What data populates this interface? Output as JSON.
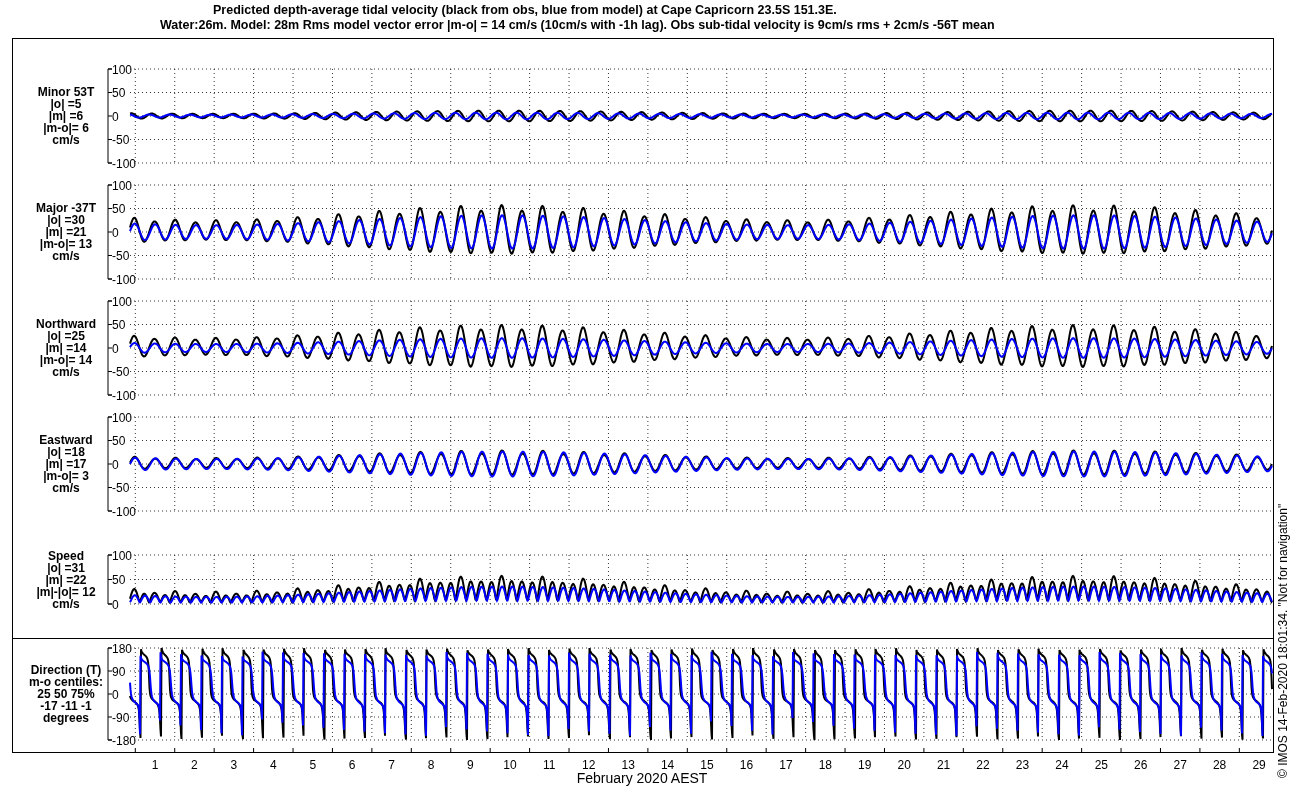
{
  "title_lines": [
    "Predicted depth-average tidal velocity (black from obs, blue from model) at Cape Capricorn 23.5S 151.3E.",
    "Water:26m. Model: 28m  Rms model vector error |m-o| = 14 cm/s (10cm/s with -1h lag). Obs sub-tidal velocity is 9cm/s rms + 2cm/s -56T mean"
  ],
  "traces": [
    {
      "color": "#000000"
    },
    {
      "color": "#0000ff"
    }
  ],
  "panels": [
    {
      "kind": "minor",
      "label_lines": [
        "Minor 53T",
        "|o| =5",
        "|m| =6",
        "|m-o|= 6",
        "cm/s"
      ],
      "yticks": [
        "100",
        "50",
        "0",
        "-50",
        "-100"
      ]
    },
    {
      "kind": "major",
      "label_lines": [
        "Major -37T",
        "|o| =30",
        "|m| =21",
        "|m-o|= 13",
        "cm/s"
      ],
      "yticks": [
        "100",
        "50",
        "0",
        "-50",
        "-100"
      ]
    },
    {
      "kind": "north",
      "label_lines": [
        "Northward",
        "|o| =25",
        "|m| =14",
        "|m-o|= 14",
        "cm/s"
      ],
      "yticks": [
        "100",
        "50",
        "0",
        "-50",
        "-100"
      ]
    },
    {
      "kind": "east",
      "label_lines": [
        "Eastward",
        "|o| =18",
        "|m| =17",
        "|m-o|= 3",
        "cm/s"
      ],
      "yticks": [
        "100",
        "50",
        "0",
        "-50",
        "-100"
      ]
    },
    {
      "kind": "speed",
      "label_lines": [
        "Speed",
        "|o| =31",
        "|m| =22",
        "|m|-|o|= 12",
        "cm/s"
      ],
      "yticks": [
        "100",
        "50",
        "0"
      ]
    },
    {
      "kind": "direction",
      "label_lines": [
        "Direction (T)",
        "m-o centiles:",
        "25  50  75%",
        "-17 -11  -1",
        "degrees"
      ],
      "yticks": [
        "180",
        "90",
        "0",
        "-90",
        "-180"
      ]
    }
  ],
  "x_labels": [
    "1",
    "2",
    "3",
    "4",
    "5",
    "6",
    "7",
    "8",
    "9",
    "10",
    "11",
    "12",
    "13",
    "14",
    "15",
    "16",
    "17",
    "18",
    "19",
    "20",
    "21",
    "22",
    "23",
    "24",
    "25",
    "26",
    "27",
    "28",
    "29"
  ],
  "xlabel": "February 2020 AEST",
  "credit": "© IMOS 14-Feb-2020 18:01:34. \"Not for navigation\""
}
